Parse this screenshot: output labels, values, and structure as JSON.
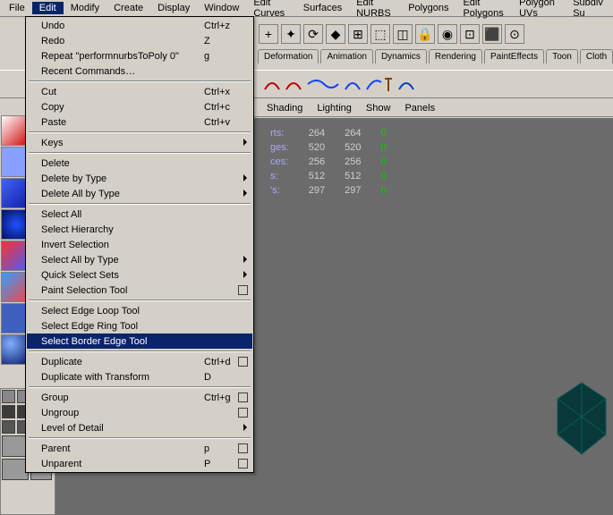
{
  "menubar": {
    "items": [
      "File",
      "Edit",
      "Modify",
      "Create",
      "Display",
      "Window",
      "Edit Curves",
      "Surfaces",
      "Edit NURBS",
      "Polygons",
      "Edit Polygons",
      "Polygon UVs",
      "Subdiv Su"
    ],
    "open_index": 1
  },
  "edit_menu": {
    "sections": [
      [
        {
          "label": "Undo",
          "shortcut": "Ctrl+z"
        },
        {
          "label": "Redo",
          "shortcut": "Z"
        },
        {
          "label": "Repeat \"performnurbsToPoly 0\"",
          "shortcut": "g"
        },
        {
          "label": "Recent Commands…"
        }
      ],
      [
        {
          "label": "Cut",
          "shortcut": "Ctrl+x"
        },
        {
          "label": "Copy",
          "shortcut": "Ctrl+c"
        },
        {
          "label": "Paste",
          "shortcut": "Ctrl+v"
        }
      ],
      [
        {
          "label": "Keys",
          "submenu": true
        }
      ],
      [
        {
          "label": "Delete"
        },
        {
          "label": "Delete by Type",
          "submenu": true
        },
        {
          "label": "Delete All by Type",
          "submenu": true
        }
      ],
      [
        {
          "label": "Select All"
        },
        {
          "label": "Select Hierarchy"
        },
        {
          "label": "Invert Selection"
        },
        {
          "label": "Select All by Type",
          "submenu": true
        },
        {
          "label": "Quick Select Sets",
          "submenu": true
        },
        {
          "label": "Paint Selection Tool",
          "optbox": true
        }
      ],
      [
        {
          "label": "Select Edge Loop Tool"
        },
        {
          "label": "Select Edge Ring Tool"
        },
        {
          "label": "Select Border Edge Tool",
          "highlight": true
        }
      ],
      [
        {
          "label": "Duplicate",
          "shortcut": "Ctrl+d",
          "optbox": true
        },
        {
          "label": "Duplicate with Transform",
          "shortcut": "D"
        }
      ],
      [
        {
          "label": "Group",
          "shortcut": "Ctrl+g",
          "optbox": true
        },
        {
          "label": "Ungroup",
          "optbox": true
        },
        {
          "label": "Level of Detail",
          "submenu": true
        }
      ],
      [
        {
          "label": "Parent",
          "shortcut": "p",
          "optbox": true
        },
        {
          "label": "Unparent",
          "shortcut": "P",
          "optbox": true
        }
      ]
    ]
  },
  "shelf_tabs": [
    "Deformation",
    "Animation",
    "Dynamics",
    "Rendering",
    "PaintEffects",
    "Toon",
    "Cloth"
  ],
  "viewport_menu": [
    "Shading",
    "Lighting",
    "Show",
    "Panels"
  ],
  "stats": {
    "rows": [
      {
        "label": "rts:",
        "a": "264",
        "b": "264",
        "c": "0"
      },
      {
        "label": "ges:",
        "a": "520",
        "b": "520",
        "c": "0"
      },
      {
        "label": "ces:",
        "a": "256",
        "b": "256",
        "c": "0"
      },
      {
        "label": "s:",
        "a": "512",
        "b": "512",
        "c": "0"
      },
      {
        "label": "'s:",
        "a": "297",
        "b": "297",
        "c": "0"
      }
    ]
  },
  "upper_icons": [
    "+",
    "✦",
    "⟳",
    "◆",
    "⊞",
    "⬚",
    "◫",
    "🔒",
    "◉",
    "⊡",
    "⬛",
    "⊙"
  ]
}
